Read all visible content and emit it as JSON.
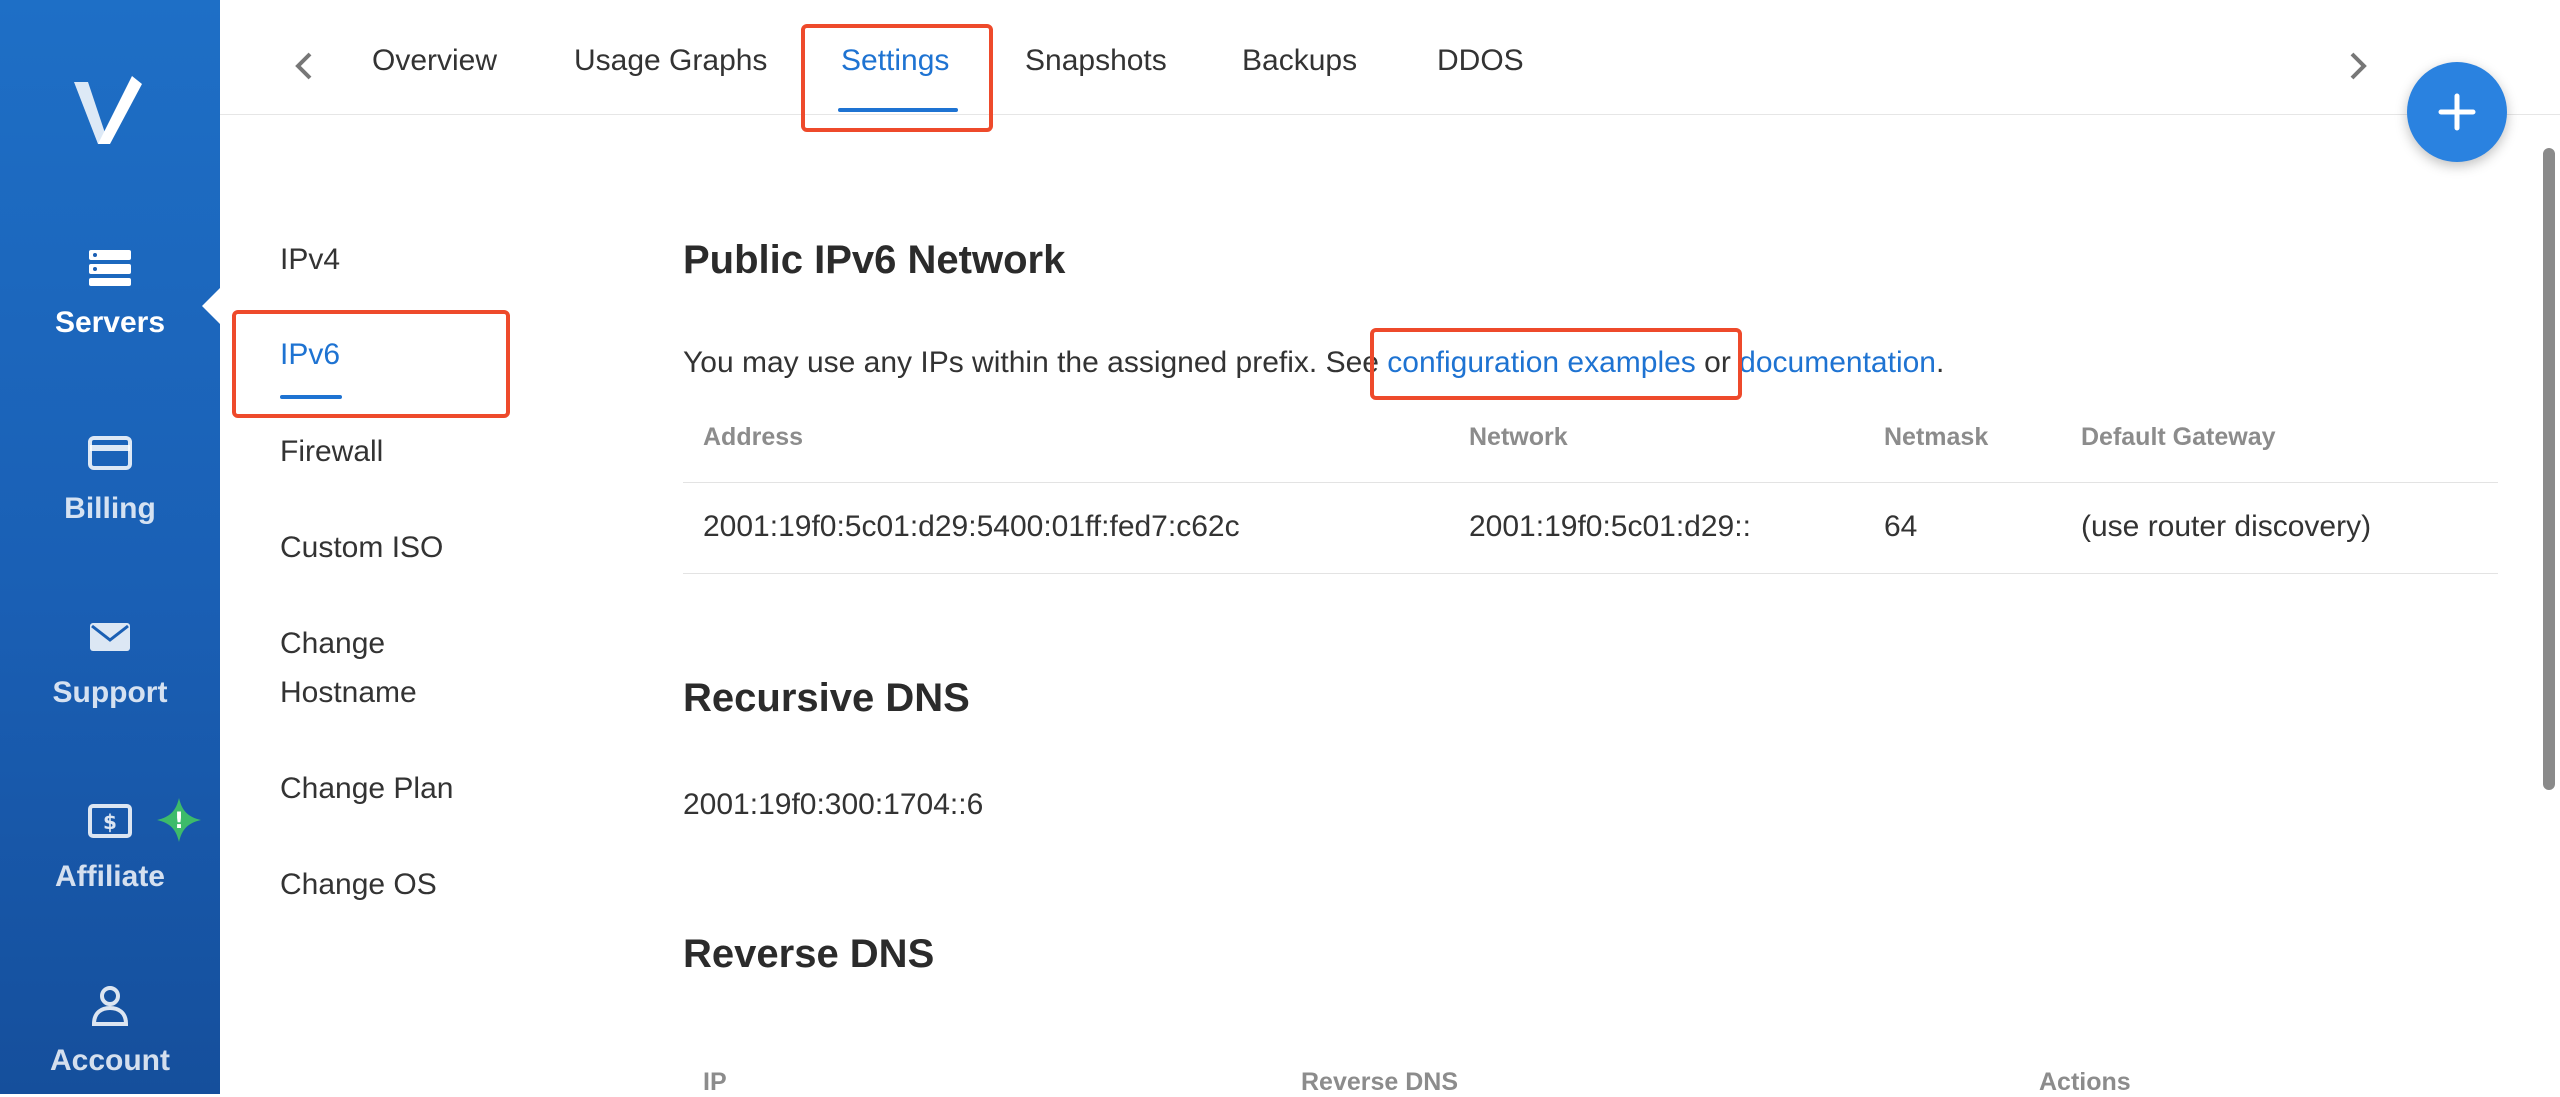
{
  "sidebar": {
    "logo_icon": "vultr-logo-icon",
    "items": [
      {
        "label": "Servers",
        "icon": "servers-icon",
        "active": true
      },
      {
        "label": "Billing",
        "icon": "credit-card-icon"
      },
      {
        "label": "Support",
        "icon": "envelope-icon"
      },
      {
        "label": "Affiliate",
        "icon": "dollar-bill-icon",
        "badge": "!"
      },
      {
        "label": "Account",
        "icon": "user-icon"
      }
    ]
  },
  "tabs": {
    "items": [
      "Overview",
      "Usage Graphs",
      "Settings",
      "Snapshots",
      "Backups",
      "DDOS"
    ],
    "active": "Settings"
  },
  "fab": {
    "icon": "plus-icon"
  },
  "subnav": {
    "items": [
      "IPv4",
      "IPv6",
      "Firewall",
      "Custom ISO",
      "Change",
      "Hostname",
      "Change Plan",
      "Change OS"
    ],
    "active": "IPv6"
  },
  "ipv6": {
    "title": "Public IPv6 Network",
    "intro_text": "You may use any IPs within the assigned prefix. See ",
    "link1": "configuration examples",
    "middle_text": " or ",
    "link2": "documentation",
    "end_text": ".",
    "columns": [
      "Address",
      "Network",
      "Netmask",
      "Default Gateway"
    ],
    "rows": [
      [
        "2001:19f0:5c01:d29:5400:01ff:fed7:c62c",
        "2001:19f0:5c01:d29::",
        "64",
        "(use router discovery)"
      ]
    ]
  },
  "recursive_dns": {
    "title": "Recursive DNS",
    "value": "2001:19f0:300:1704::6"
  },
  "reverse_dns": {
    "title": "Reverse DNS",
    "columns": [
      "IP",
      "Reverse DNS",
      "Actions"
    ]
  },
  "colors": {
    "accent": "#1e73d2",
    "sidebar": "#1a5fb4",
    "highlight": "#ee4a2b",
    "badge": "#3dbb6a"
  }
}
